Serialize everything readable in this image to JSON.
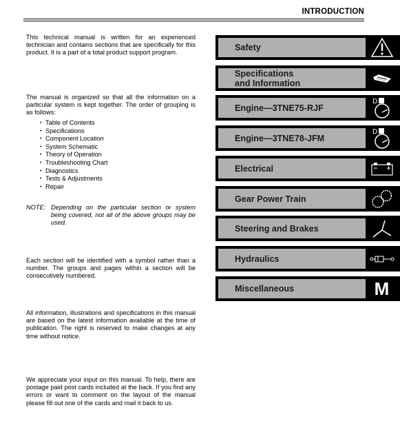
{
  "header": {
    "title": "INTRODUCTION"
  },
  "body": {
    "intro": "This technical manual is written for an experienced technician and contains sections that are specifically for this product. It is a part of a total product support program.",
    "organization": "The manual is organized so that all the information on a particular system is kept together. The order of grouping is as follows:",
    "groups": [
      "Table of Contents",
      "Specifications",
      "Component Location",
      "System Schematic",
      "Theory of Operation",
      "Troubleshooting Chart",
      "Diagnostics",
      "Tests & Adjustments",
      "Repair"
    ],
    "note_label": "NOTE:",
    "note_text": "Depending on the particular section or system being covered, not all of the above groups may be used.",
    "sections": "Each section will be identified with a symbol rather than a number. The groups and pages within a section will be consecutively numbered.",
    "disclaimer": "All information, illustrations and specifications in this manual are based on the latest information available at the time of publication. The right is reserved to make changes at any time without notice.",
    "feedback": "We appreciate your input on this manual. To help, there are postage paid post cards included at the back. If you find any errors or want to comment on the layout of the manual please fill out one of the cards and mail it back to us."
  },
  "tabs": [
    {
      "label": "Safety",
      "icon": "warning-triangle-icon"
    },
    {
      "label_line1": "Specifications",
      "label_line2": "and Information",
      "icon": "book-icon"
    },
    {
      "label": "Engine—3TNE75-RJF",
      "icon": "engine-gauge-icon"
    },
    {
      "label": "Engine—3TNE78-JFM",
      "icon": "engine-gauge-icon"
    },
    {
      "label": "Electrical",
      "icon": "battery-icon"
    },
    {
      "label": "Gear Power Train",
      "icon": "gears-icon"
    },
    {
      "label": "Steering and Brakes",
      "icon": "steering-icon"
    },
    {
      "label": "Hydraulics",
      "icon": "hydraulic-cylinder-icon"
    },
    {
      "label": "Miscellaneous",
      "icon": "letter-m-icon",
      "icon_glyph": "M"
    }
  ],
  "colors": {
    "tab_background": "#000000",
    "tab_label_fill": "#b0b0b0",
    "tab_text": "#1a1a1a",
    "icon_color": "#ffffff"
  }
}
